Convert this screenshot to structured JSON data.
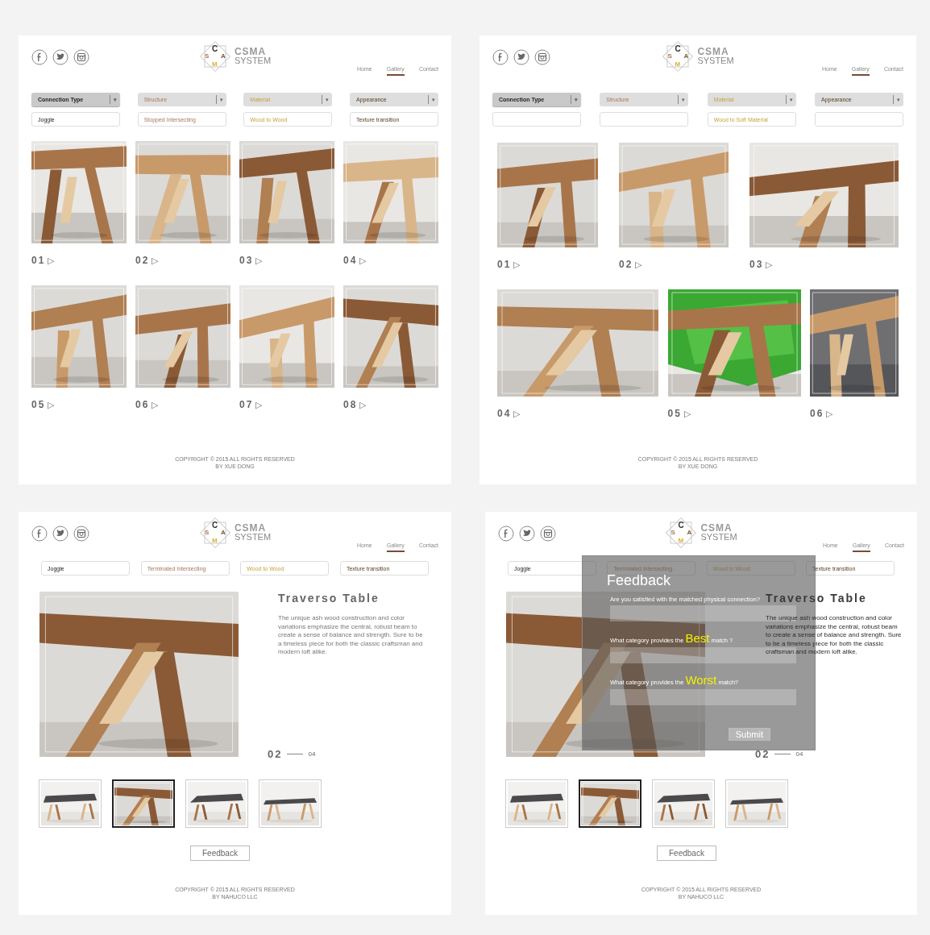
{
  "screens": [
    {
      "kind": "gallery",
      "header": {
        "logo": {
          "letters": [
            "C",
            "S",
            "A",
            "M"
          ],
          "title": "CSMA",
          "subtitle": "SYSTEM"
        },
        "nav": [
          {
            "label": "Home",
            "selected": false
          },
          {
            "label": "Gallery",
            "selected": true
          },
          {
            "label": "Contact",
            "selected": false
          }
        ]
      },
      "filters": [
        {
          "label": "Connection Type",
          "value": "Joggle",
          "caret": "▾",
          "selected": true
        },
        {
          "label": "Structure",
          "value": "Stopped Intersecting",
          "caret": "▾",
          "selected": false
        },
        {
          "label": "Material",
          "value": "Wood to Wood",
          "caret": "▾",
          "selected": false
        },
        {
          "label": "Appearance",
          "value": "Texture transition",
          "caret": "▾",
          "selected": false
        }
      ],
      "gallery": {
        "rows": [
          [
            {
              "number": "01",
              "icon": "▷"
            },
            {
              "number": "02",
              "icon": "▷"
            },
            {
              "number": "03",
              "icon": "▷"
            },
            {
              "number": "04",
              "icon": "▷"
            }
          ],
          [
            {
              "number": "05",
              "icon": "▷"
            },
            {
              "number": "06",
              "icon": "▷"
            },
            {
              "number": "07",
              "icon": "▷"
            },
            {
              "number": "08",
              "icon": "▷"
            }
          ]
        ]
      },
      "footer": [
        "COPYRIGHT © 2015 ALL RIGHTS RESERVED",
        "BY XUE DONG"
      ]
    },
    {
      "kind": "gallery",
      "header": {
        "logo": {
          "letters": [
            "C",
            "S",
            "A",
            "M"
          ],
          "title": "CSMA",
          "subtitle": "SYSTEM"
        },
        "nav": [
          {
            "label": "Home",
            "selected": false
          },
          {
            "label": "Gallery",
            "selected": true
          },
          {
            "label": "Contact",
            "selected": false
          }
        ]
      },
      "filters": [
        {
          "label": "Connection Type",
          "caret": "▾",
          "selected": true
        },
        {
          "label": "Structure",
          "caret": "▾",
          "selected": false
        },
        {
          "label": "Material",
          "value": "Wood to Soft Material",
          "caret": "▾",
          "selected": false
        },
        {
          "label": "Appearance",
          "caret": "▾",
          "selected": false
        }
      ],
      "gallery": {
        "rows": [
          [
            {
              "number": "01",
              "icon": "▷"
            },
            {
              "number": "02",
              "icon": "▷"
            },
            {
              "number": "03",
              "icon": "▷"
            }
          ],
          [
            {
              "number": "04",
              "icon": "▷"
            },
            {
              "number": "05",
              "icon": "▷"
            },
            {
              "number": "06",
              "icon": "▷"
            }
          ]
        ]
      },
      "footer": [
        "COPYRIGHT © 2015 ALL RIGHTS RESERVED",
        "BY XUE DONG"
      ]
    },
    {
      "kind": "detail",
      "header": {
        "logo": {
          "letters": [
            "C",
            "S",
            "A",
            "M"
          ],
          "title": "CSMA",
          "subtitle": "SYSTEM"
        },
        "nav": [
          {
            "label": "Home",
            "selected": false
          },
          {
            "label": "Gallery",
            "selected": true
          },
          {
            "label": "Contact",
            "selected": false
          }
        ]
      },
      "fields": [
        "Joggle",
        "Terminated Intersecting",
        "Wood to Wood",
        "Texture transition"
      ],
      "product": {
        "title": "Traverso Table",
        "description": "The unique ash wood construction and color variations emphasize the central, robust beam to create a sense of balance and strength. Sure to be a timeless piece for both the classic craftsman and modern loft alike."
      },
      "pager": {
        "current": "02",
        "total": "04"
      },
      "thumbnails": [
        {
          "selected": false
        },
        {
          "selected": true
        },
        {
          "selected": false
        },
        {
          "selected": false
        }
      ],
      "feedback_button": "Feedback",
      "footer": [
        "COPYRIGHT © 2015 ALL RIGHTS RESERVED",
        "BY NAHUCO LLC"
      ]
    },
    {
      "kind": "detail",
      "header": {
        "logo": {
          "letters": [
            "C",
            "S",
            "A",
            "M"
          ],
          "title": "CSMA",
          "subtitle": "SYSTEM"
        },
        "nav": [
          {
            "label": "Home",
            "selected": false
          },
          {
            "label": "Gallery",
            "selected": true
          },
          {
            "label": "Contact",
            "selected": false
          }
        ]
      },
      "fields": [
        "Joggle",
        "Terminated Intersecting",
        "Wood to Wood",
        "Texture transition"
      ],
      "product": {
        "title": "Traverso Table",
        "description": "The unique ash wood construction and color variations emphasize the central, robust beam to create a sense of balance and strength. Sure to be a timeless piece for both the classic craftsman and modern loft alike."
      },
      "pager": {
        "current": "02",
        "total": "04"
      },
      "thumbnails": [
        {
          "selected": false
        },
        {
          "selected": true
        },
        {
          "selected": false
        },
        {
          "selected": false
        }
      ],
      "feedback_button": "Feedback",
      "dialog": {
        "title": "Feedback",
        "questions": [
          {
            "kind": "plain",
            "text": "Are you satisfied with the matched physical connection?"
          },
          {
            "kind": "highlight",
            "before": "What category  provides the",
            "highlight": "Best",
            "after": "match ?"
          },
          {
            "kind": "highlight",
            "before": "What category provides the",
            "highlight": "Worst",
            "after": "match?"
          }
        ],
        "submit": "Submit"
      },
      "footer": [
        "COPYRIGHT © 2015 ALL RIGHTS RESERVED",
        "BY NAHUCO LLC"
      ]
    }
  ]
}
